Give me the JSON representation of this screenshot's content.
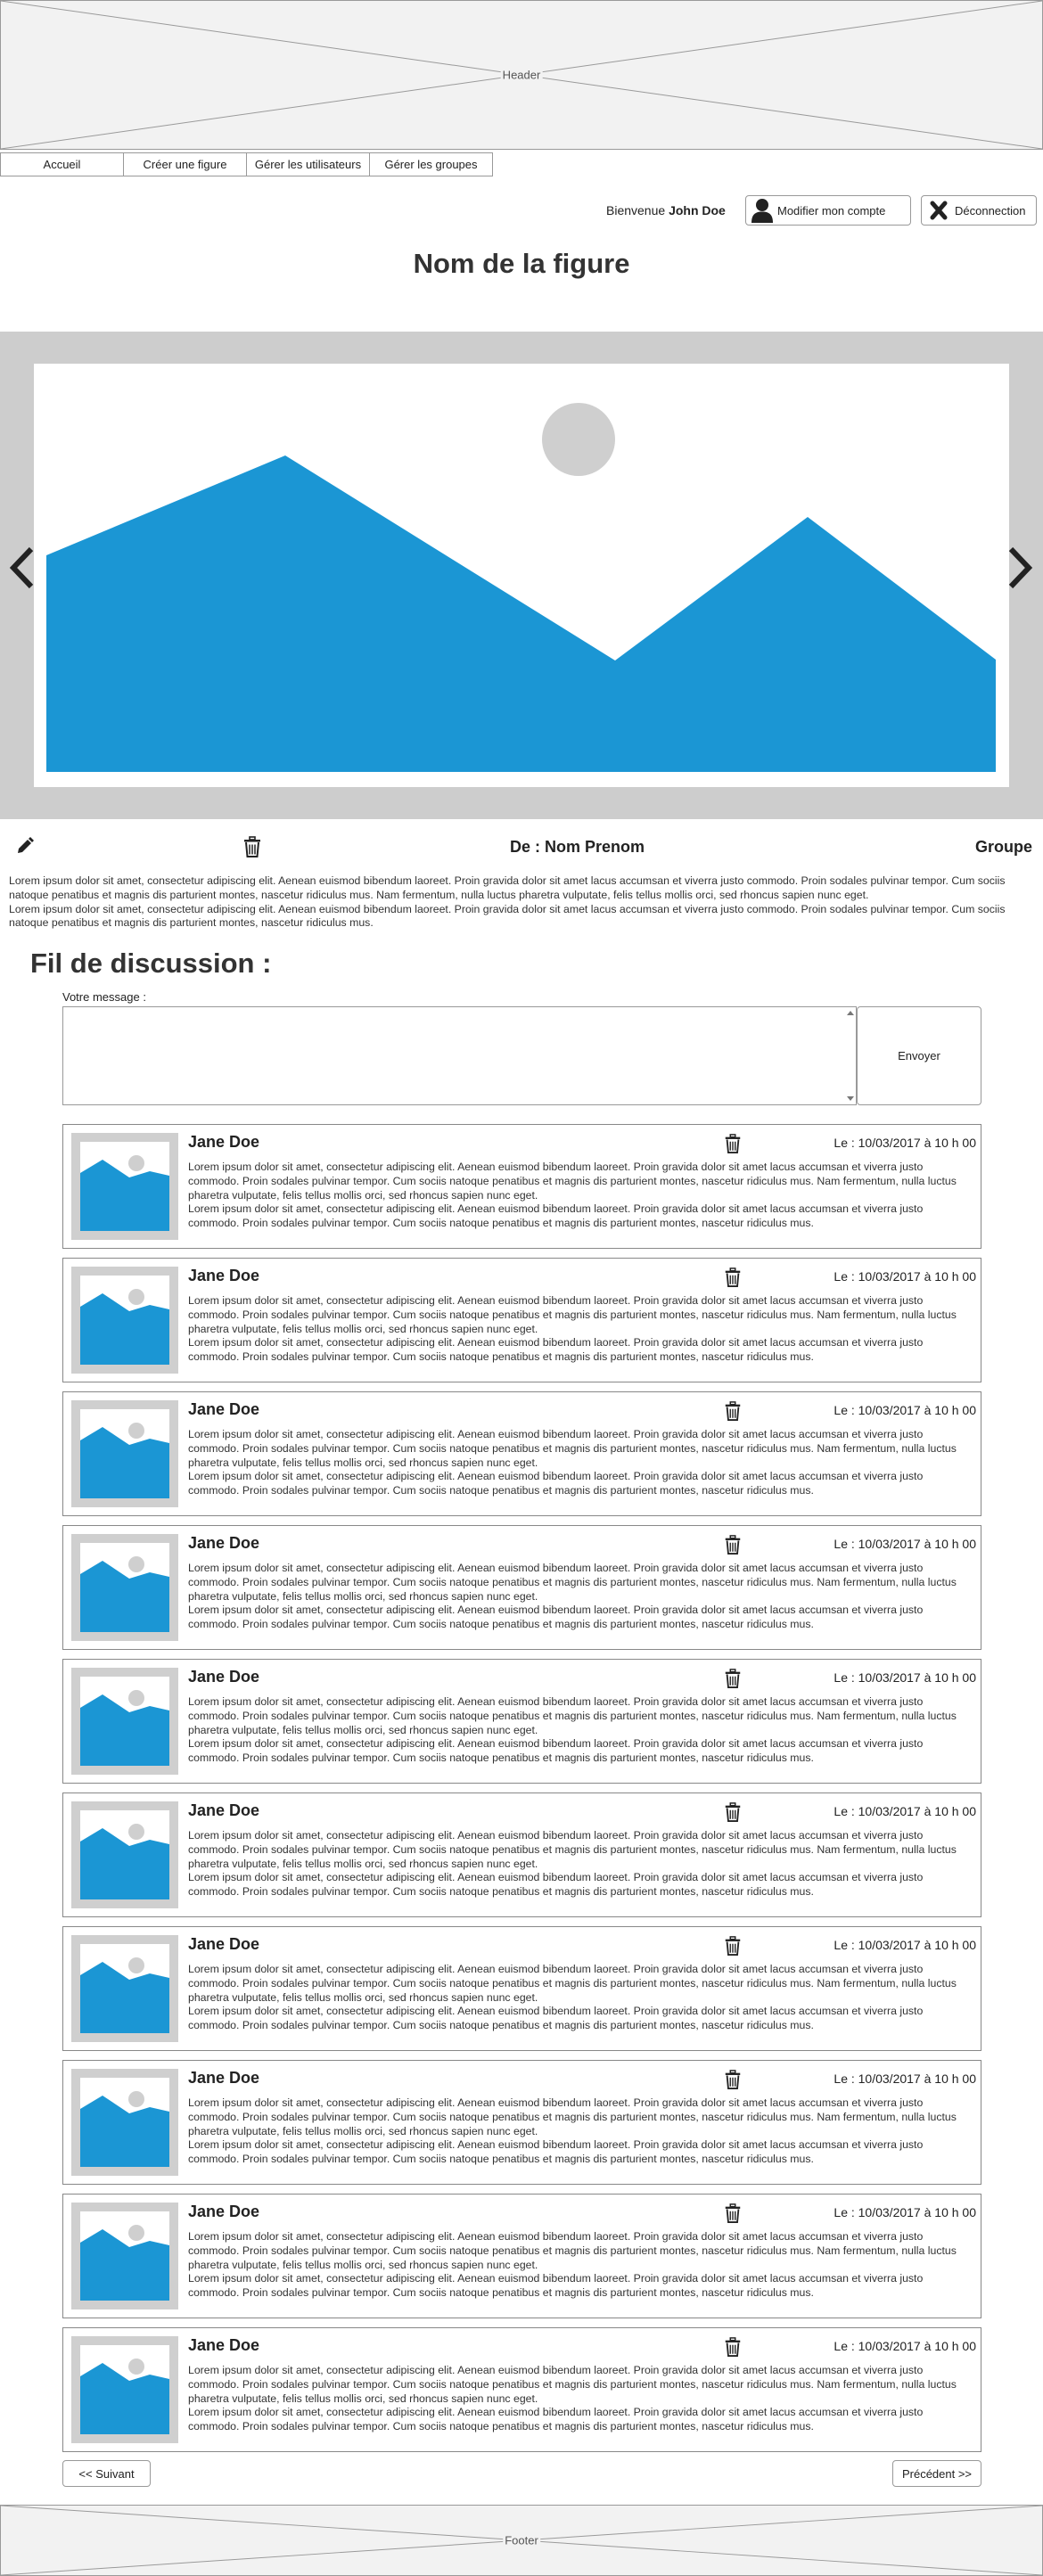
{
  "header": {
    "label": "Header"
  },
  "footer": {
    "label": "Footer"
  },
  "nav": {
    "items": [
      {
        "label": "Accueil"
      },
      {
        "label": "Créer une figure"
      },
      {
        "label": "Gérer les utilisateurs"
      },
      {
        "label": "Gérer les groupes"
      }
    ]
  },
  "account": {
    "welcome_prefix": "Bienvenue",
    "username": "John Doe",
    "edit_account_label": "Modifier mon compte",
    "logout_label": "Déconnection",
    "edit_account_icon": "user-icon",
    "logout_icon": "close-icon"
  },
  "figure": {
    "title": "Nom de la figure",
    "author": "De : Nom Prenom",
    "group": "Groupe",
    "description_lines": [
      "Lorem ipsum dolor sit amet, consectetur adipiscing elit. Aenean euismod bibendum laoreet. Proin gravida dolor sit amet lacus accumsan et viverra justo commodo. Proin sodales pulvinar tempor. Cum sociis natoque penatibus et magnis dis parturient montes, nascetur ridiculus mus. Nam fermentum, nulla luctus pharetra vulputate, felis tellus mollis orci, sed rhoncus sapien nunc eget.",
      "Lorem ipsum dolor sit amet, consectetur adipiscing elit. Aenean euismod bibendum laoreet. Proin gravida dolor sit amet lacus accumsan et viverra justo commodo. Proin sodales pulvinar tempor. Cum sociis natoque penatibus et magnis dis parturient montes, nascetur ridiculus mus."
    ]
  },
  "carousel": {
    "prev_icon": "chevron-left-icon",
    "next_icon": "chevron-right-icon",
    "image_icon": "image-placeholder-icon"
  },
  "discussion": {
    "title": "Fil de discussion :",
    "message_label": "Votre message :",
    "message_value": "",
    "send_label": "Envoyer",
    "comments": [
      {
        "author": "Jane Doe",
        "date": "Le : 10/03/2017 à 10 h 00",
        "line1": "Lorem ipsum dolor sit amet, consectetur adipiscing elit. Aenean euismod bibendum laoreet. Proin gravida dolor sit amet lacus accumsan et viverra justo commodo. Proin sodales pulvinar tempor. Cum sociis natoque penatibus et magnis dis parturient montes, nascetur ridiculus mus. Nam fermentum, nulla luctus pharetra vulputate, felis tellus mollis orci, sed rhoncus sapien nunc eget.",
        "line2": "Lorem ipsum dolor sit amet, consectetur adipiscing elit. Aenean euismod bibendum laoreet. Proin gravida dolor sit amet lacus accumsan et viverra justo commodo. Proin sodales pulvinar tempor. Cum sociis natoque penatibus et magnis dis parturient montes, nascetur ridiculus mus."
      },
      {
        "author": "Jane Doe",
        "date": "Le : 10/03/2017 à 10 h 00",
        "line1": "Lorem ipsum dolor sit amet, consectetur adipiscing elit. Aenean euismod bibendum laoreet. Proin gravida dolor sit amet lacus accumsan et viverra justo commodo. Proin sodales pulvinar tempor. Cum sociis natoque penatibus et magnis dis parturient montes, nascetur ridiculus mus. Nam fermentum, nulla luctus pharetra vulputate, felis tellus mollis orci, sed rhoncus sapien nunc eget.",
        "line2": "Lorem ipsum dolor sit amet, consectetur adipiscing elit. Aenean euismod bibendum laoreet. Proin gravida dolor sit amet lacus accumsan et viverra justo commodo. Proin sodales pulvinar tempor. Cum sociis natoque penatibus et magnis dis parturient montes, nascetur ridiculus mus."
      },
      {
        "author": "Jane Doe",
        "date": "Le : 10/03/2017 à 10 h 00",
        "line1": "Lorem ipsum dolor sit amet, consectetur adipiscing elit. Aenean euismod bibendum laoreet. Proin gravida dolor sit amet lacus accumsan et viverra justo commodo. Proin sodales pulvinar tempor. Cum sociis natoque penatibus et magnis dis parturient montes, nascetur ridiculus mus. Nam fermentum, nulla luctus pharetra vulputate, felis tellus mollis orci, sed rhoncus sapien nunc eget.",
        "line2": "Lorem ipsum dolor sit amet, consectetur adipiscing elit. Aenean euismod bibendum laoreet. Proin gravida dolor sit amet lacus accumsan et viverra justo commodo. Proin sodales pulvinar tempor. Cum sociis natoque penatibus et magnis dis parturient montes, nascetur ridiculus mus."
      },
      {
        "author": "Jane Doe",
        "date": "Le : 10/03/2017 à 10 h 00",
        "line1": "Lorem ipsum dolor sit amet, consectetur adipiscing elit. Aenean euismod bibendum laoreet. Proin gravida dolor sit amet lacus accumsan et viverra justo commodo. Proin sodales pulvinar tempor. Cum sociis natoque penatibus et magnis dis parturient montes, nascetur ridiculus mus. Nam fermentum, nulla luctus pharetra vulputate, felis tellus mollis orci, sed rhoncus sapien nunc eget.",
        "line2": "Lorem ipsum dolor sit amet, consectetur adipiscing elit. Aenean euismod bibendum laoreet. Proin gravida dolor sit amet lacus accumsan et viverra justo commodo. Proin sodales pulvinar tempor. Cum sociis natoque penatibus et magnis dis parturient montes, nascetur ridiculus mus."
      },
      {
        "author": "Jane Doe",
        "date": "Le : 10/03/2017 à 10 h 00",
        "line1": "Lorem ipsum dolor sit amet, consectetur adipiscing elit. Aenean euismod bibendum laoreet. Proin gravida dolor sit amet lacus accumsan et viverra justo commodo. Proin sodales pulvinar tempor. Cum sociis natoque penatibus et magnis dis parturient montes, nascetur ridiculus mus. Nam fermentum, nulla luctus pharetra vulputate, felis tellus mollis orci, sed rhoncus sapien nunc eget.",
        "line2": "Lorem ipsum dolor sit amet, consectetur adipiscing elit. Aenean euismod bibendum laoreet. Proin gravida dolor sit amet lacus accumsan et viverra justo commodo. Proin sodales pulvinar tempor. Cum sociis natoque penatibus et magnis dis parturient montes, nascetur ridiculus mus."
      },
      {
        "author": "Jane Doe",
        "date": "Le : 10/03/2017 à 10 h 00",
        "line1": "Lorem ipsum dolor sit amet, consectetur adipiscing elit. Aenean euismod bibendum laoreet. Proin gravida dolor sit amet lacus accumsan et viverra justo commodo. Proin sodales pulvinar tempor. Cum sociis natoque penatibus et magnis dis parturient montes, nascetur ridiculus mus. Nam fermentum, nulla luctus pharetra vulputate, felis tellus mollis orci, sed rhoncus sapien nunc eget.",
        "line2": "Lorem ipsum dolor sit amet, consectetur adipiscing elit. Aenean euismod bibendum laoreet. Proin gravida dolor sit amet lacus accumsan et viverra justo commodo. Proin sodales pulvinar tempor. Cum sociis natoque penatibus et magnis dis parturient montes, nascetur ridiculus mus."
      },
      {
        "author": "Jane Doe",
        "date": "Le : 10/03/2017 à 10 h 00",
        "line1": "Lorem ipsum dolor sit amet, consectetur adipiscing elit. Aenean euismod bibendum laoreet. Proin gravida dolor sit amet lacus accumsan et viverra justo commodo. Proin sodales pulvinar tempor. Cum sociis natoque penatibus et magnis dis parturient montes, nascetur ridiculus mus. Nam fermentum, nulla luctus pharetra vulputate, felis tellus mollis orci, sed rhoncus sapien nunc eget.",
        "line2": "Lorem ipsum dolor sit amet, consectetur adipiscing elit. Aenean euismod bibendum laoreet. Proin gravida dolor sit amet lacus accumsan et viverra justo commodo. Proin sodales pulvinar tempor. Cum sociis natoque penatibus et magnis dis parturient montes, nascetur ridiculus mus."
      },
      {
        "author": "Jane Doe",
        "date": "Le : 10/03/2017 à 10 h 00",
        "line1": "Lorem ipsum dolor sit amet, consectetur adipiscing elit. Aenean euismod bibendum laoreet. Proin gravida dolor sit amet lacus accumsan et viverra justo commodo. Proin sodales pulvinar tempor. Cum sociis natoque penatibus et magnis dis parturient montes, nascetur ridiculus mus. Nam fermentum, nulla luctus pharetra vulputate, felis tellus mollis orci, sed rhoncus sapien nunc eget.",
        "line2": "Lorem ipsum dolor sit amet, consectetur adipiscing elit. Aenean euismod bibendum laoreet. Proin gravida dolor sit amet lacus accumsan et viverra justo commodo. Proin sodales pulvinar tempor. Cum sociis natoque penatibus et magnis dis parturient montes, nascetur ridiculus mus."
      },
      {
        "author": "Jane Doe",
        "date": "Le : 10/03/2017 à 10 h 00",
        "line1": "Lorem ipsum dolor sit amet, consectetur adipiscing elit. Aenean euismod bibendum laoreet. Proin gravida dolor sit amet lacus accumsan et viverra justo commodo. Proin sodales pulvinar tempor. Cum sociis natoque penatibus et magnis dis parturient montes, nascetur ridiculus mus. Nam fermentum, nulla luctus pharetra vulputate, felis tellus mollis orci, sed rhoncus sapien nunc eget.",
        "line2": "Lorem ipsum dolor sit amet, consectetur adipiscing elit. Aenean euismod bibendum laoreet. Proin gravida dolor sit amet lacus accumsan et viverra justo commodo. Proin sodales pulvinar tempor. Cum sociis natoque penatibus et magnis dis parturient montes, nascetur ridiculus mus."
      },
      {
        "author": "Jane Doe",
        "date": "Le : 10/03/2017 à 10 h 00",
        "line1": "Lorem ipsum dolor sit amet, consectetur adipiscing elit. Aenean euismod bibendum laoreet. Proin gravida dolor sit amet lacus accumsan et viverra justo commodo. Proin sodales pulvinar tempor. Cum sociis natoque penatibus et magnis dis parturient montes, nascetur ridiculus mus. Nam fermentum, nulla luctus pharetra vulputate, felis tellus mollis orci, sed rhoncus sapien nunc eget.",
        "line2": "Lorem ipsum dolor sit amet, consectetur adipiscing elit. Aenean euismod bibendum laoreet. Proin gravida dolor sit amet lacus accumsan et viverra justo commodo. Proin sodales pulvinar tempor. Cum sociis natoque penatibus et magnis dis parturient montes, nascetur ridiculus mus."
      }
    ]
  },
  "pagination": {
    "next_label": "<< Suivant",
    "prev_label": "Précédent >>"
  },
  "colors": {
    "image_blue": "#1b96d4",
    "image_sun": "#cfcfcf",
    "carousel_bg": "#cdcdcd",
    "icon_dark": "#222222"
  }
}
